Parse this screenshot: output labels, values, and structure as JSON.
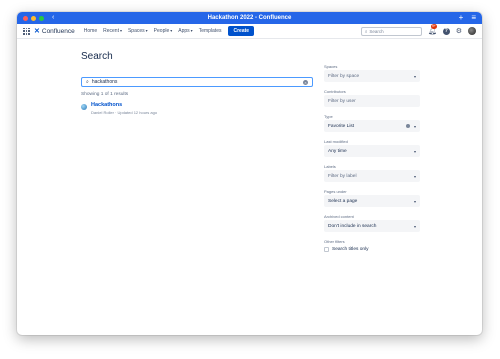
{
  "window": {
    "title": "Hackathon 2022 - Confluence",
    "traffic_colors": [
      "#ff5f57",
      "#febc2e",
      "#28c840"
    ]
  },
  "nav": {
    "logo_text": "Confluence",
    "items": [
      {
        "label": "Home",
        "dropdown": false
      },
      {
        "label": "Recent",
        "dropdown": true
      },
      {
        "label": "Spaces",
        "dropdown": true
      },
      {
        "label": "People",
        "dropdown": true
      },
      {
        "label": "Apps",
        "dropdown": true
      },
      {
        "label": "Templates",
        "dropdown": false
      }
    ],
    "create_label": "Create",
    "search_placeholder": "Search",
    "notification_count": "9+"
  },
  "page": {
    "title": "Search",
    "search_value": "hackathons",
    "summary": "Showing 1 of 1 results",
    "results": [
      {
        "title": "Hackathons",
        "meta": "Daniel Roller · Updated 12 hours ago"
      }
    ]
  },
  "filters": {
    "spaces": {
      "label": "Spaces",
      "value": "Filter by space"
    },
    "contributors": {
      "label": "Contributors",
      "value": "Filter by user"
    },
    "type": {
      "label": "Type",
      "value": "Favorite List"
    },
    "last_modified": {
      "label": "Last modified",
      "value": "Any time"
    },
    "labels": {
      "label": "Labels",
      "value": "Filter by label"
    },
    "pages_under": {
      "label": "Pages under",
      "value": "Select a page"
    },
    "archived": {
      "label": "Archived content",
      "value": "Don't include in search"
    },
    "other_label": "Other filters",
    "titles_only_label": "Search titles only",
    "titles_only_checked": false
  }
}
